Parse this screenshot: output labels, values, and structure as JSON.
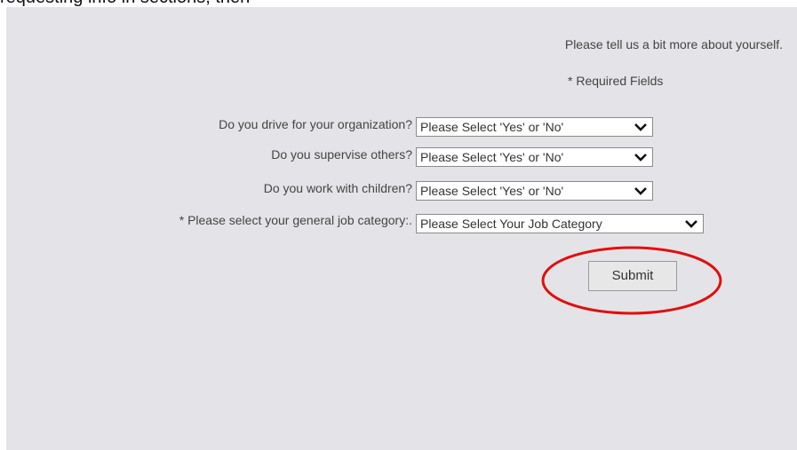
{
  "top_caption": "requesting info in sections, then",
  "form": {
    "intro_text": "Please tell us a bit more about yourself.",
    "required_note": "* Required Fields",
    "questions": [
      {
        "label": "Do you drive for your organization?",
        "value": "Please Select 'Yes' or 'No'"
      },
      {
        "label": "Do you supervise others?",
        "value": "Please Select 'Yes' or 'No'"
      },
      {
        "label": "Do you work with children?",
        "value": "Please Select 'Yes' or 'No'"
      },
      {
        "label": "* Please select your general job category:.",
        "value": "Please Select Your Job Category"
      }
    ],
    "submit_label": "Submit"
  },
  "colors": {
    "panel_background": "#e4e4e8",
    "annotation_ellipse": "#e01010"
  },
  "icons": {
    "dropdown": "chevron-down-icon"
  }
}
